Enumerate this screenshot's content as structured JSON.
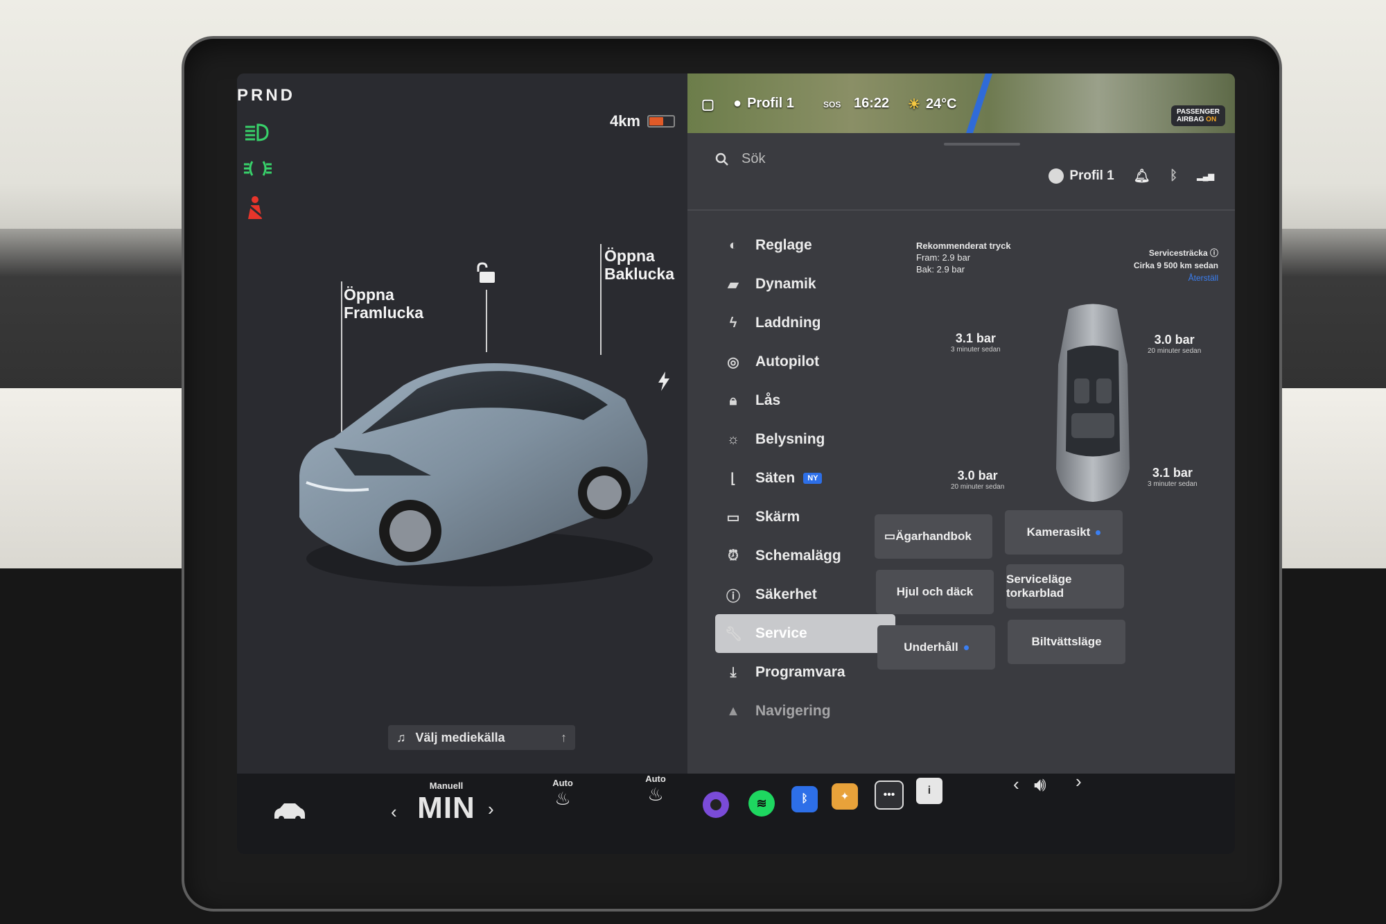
{
  "gear": "PRND",
  "range": "4km",
  "battery_level": 0.6,
  "callouts": {
    "front": [
      "Öppna",
      "Framlucka"
    ],
    "rear": [
      "Öppna",
      "Baklucka"
    ]
  },
  "media_source": "Välj mediekälla",
  "status_bar": {
    "profile": "Profil 1",
    "sos": "SOS",
    "time": "16:22",
    "temperature": "24°C",
    "airbag_line1": "PASSENGER",
    "airbag_line2": "AIRBAG",
    "airbag_state": "ON"
  },
  "search_placeholder": "Sök",
  "header_profile": "Profil 1",
  "menu": [
    {
      "label": "Reglage",
      "icon": "toggle-icon"
    },
    {
      "label": "Dynamik",
      "icon": "car-icon"
    },
    {
      "label": "Laddning",
      "icon": "bolt-icon"
    },
    {
      "label": "Autopilot",
      "icon": "steering-wheel-icon"
    },
    {
      "label": "Lås",
      "icon": "lock-icon"
    },
    {
      "label": "Belysning",
      "icon": "sun-icon"
    },
    {
      "label": "Säten",
      "icon": "seat-icon",
      "badge": "NY"
    },
    {
      "label": "Skärm",
      "icon": "display-icon"
    },
    {
      "label": "Schemalägg",
      "icon": "alarm-icon"
    },
    {
      "label": "Säkerhet",
      "icon": "info-circle-icon"
    },
    {
      "label": "Service",
      "icon": "wrench-icon",
      "active": true
    },
    {
      "label": "Programvara",
      "icon": "download-icon"
    },
    {
      "label": "Navigering",
      "icon": "navigation-icon"
    }
  ],
  "tire_pressure": {
    "heading": "Rekommenderat tryck",
    "front": "Fram: 2.9 bar",
    "rear": "Bak: 2.9 bar",
    "fl": {
      "value": "3.1 bar",
      "ago": "3 minuter sedan"
    },
    "fr": {
      "value": "3.0 bar",
      "ago": "20 minuter sedan"
    },
    "rl": {
      "value": "3.0 bar",
      "ago": "20 minuter sedan"
    },
    "rr": {
      "value": "3.1 bar",
      "ago": "3 minuter sedan"
    }
  },
  "service_distance": {
    "title": "Servicesträcka",
    "value": "Cirka 9 500 km sedan",
    "link": "Återställ"
  },
  "buttons": {
    "manual": "Ägarhandbok",
    "camera": "Kamerasikt",
    "wheels": "Hjul och däck",
    "wiper": "Serviceläge torkarblad",
    "maintenance": "Underhåll",
    "carwash": "Biltvättsläge"
  },
  "climate": {
    "fan_mode": "Manuell",
    "fan_value": "MIN",
    "seat_heat_mode": "Auto",
    "heater_mode": "Auto"
  },
  "colors": {
    "accent_blue": "#3b7ff2",
    "headlight_green": "#38d16a",
    "seatbelt_red": "#e8352b",
    "battery_orange": "#e05a28",
    "spotify_green": "#1ed760"
  }
}
